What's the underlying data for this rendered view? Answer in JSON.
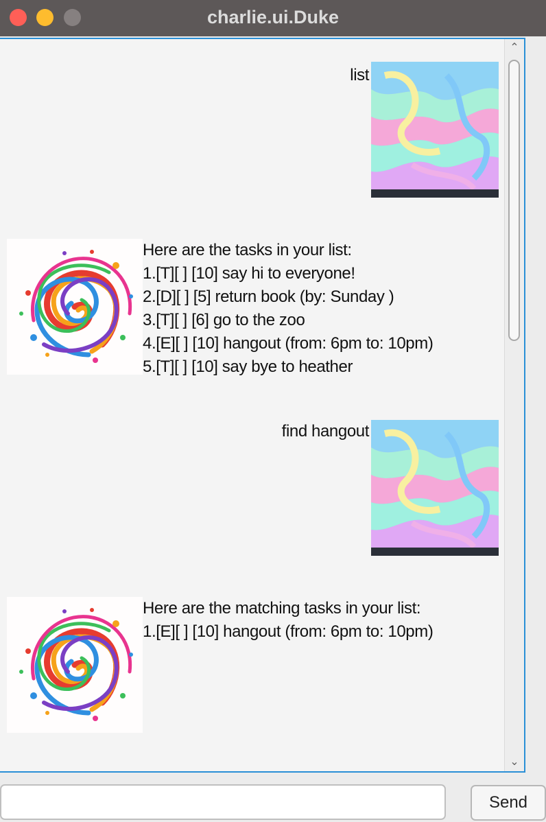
{
  "window": {
    "title": "charlie.ui.Duke",
    "controls": {
      "close_color": "#ff5f57",
      "minimize_color": "#febc2e",
      "zoom_color": "#868080"
    }
  },
  "dialog": [
    {
      "speaker": "user",
      "lines": [
        "list"
      ],
      "avatar": "holographic-swirl-image"
    },
    {
      "speaker": "bot",
      "lines": [
        "Here are the tasks in your list:",
        "1.[T][ ] [10] say hi to everyone!",
        "2.[D][ ] [5] return book (by: Sunday )",
        "3.[T][ ] [6] go to the zoo",
        "4.[E][ ] [10] hangout (from: 6pm to: 10pm)",
        "5.[T][ ] [10] say bye to heather"
      ],
      "avatar": "rainbow-spiral-logo"
    },
    {
      "speaker": "user",
      "lines": [
        "find hangout"
      ],
      "avatar": "holographic-swirl-image"
    },
    {
      "speaker": "bot",
      "lines": [
        "Here are the matching tasks in your list:",
        "1.[E][ ] [10] hangout (from: 6pm to: 10pm)"
      ],
      "avatar": "rainbow-spiral-logo"
    }
  ],
  "input": {
    "value": "",
    "placeholder": ""
  },
  "send_button": {
    "label": "Send"
  },
  "scrollbar": {
    "up_arrow": "chevron-up-icon",
    "down_arrow": "chevron-down-icon"
  },
  "colors": {
    "accent_border": "#2a8fd6",
    "chat_background": "#f4f4f4"
  }
}
